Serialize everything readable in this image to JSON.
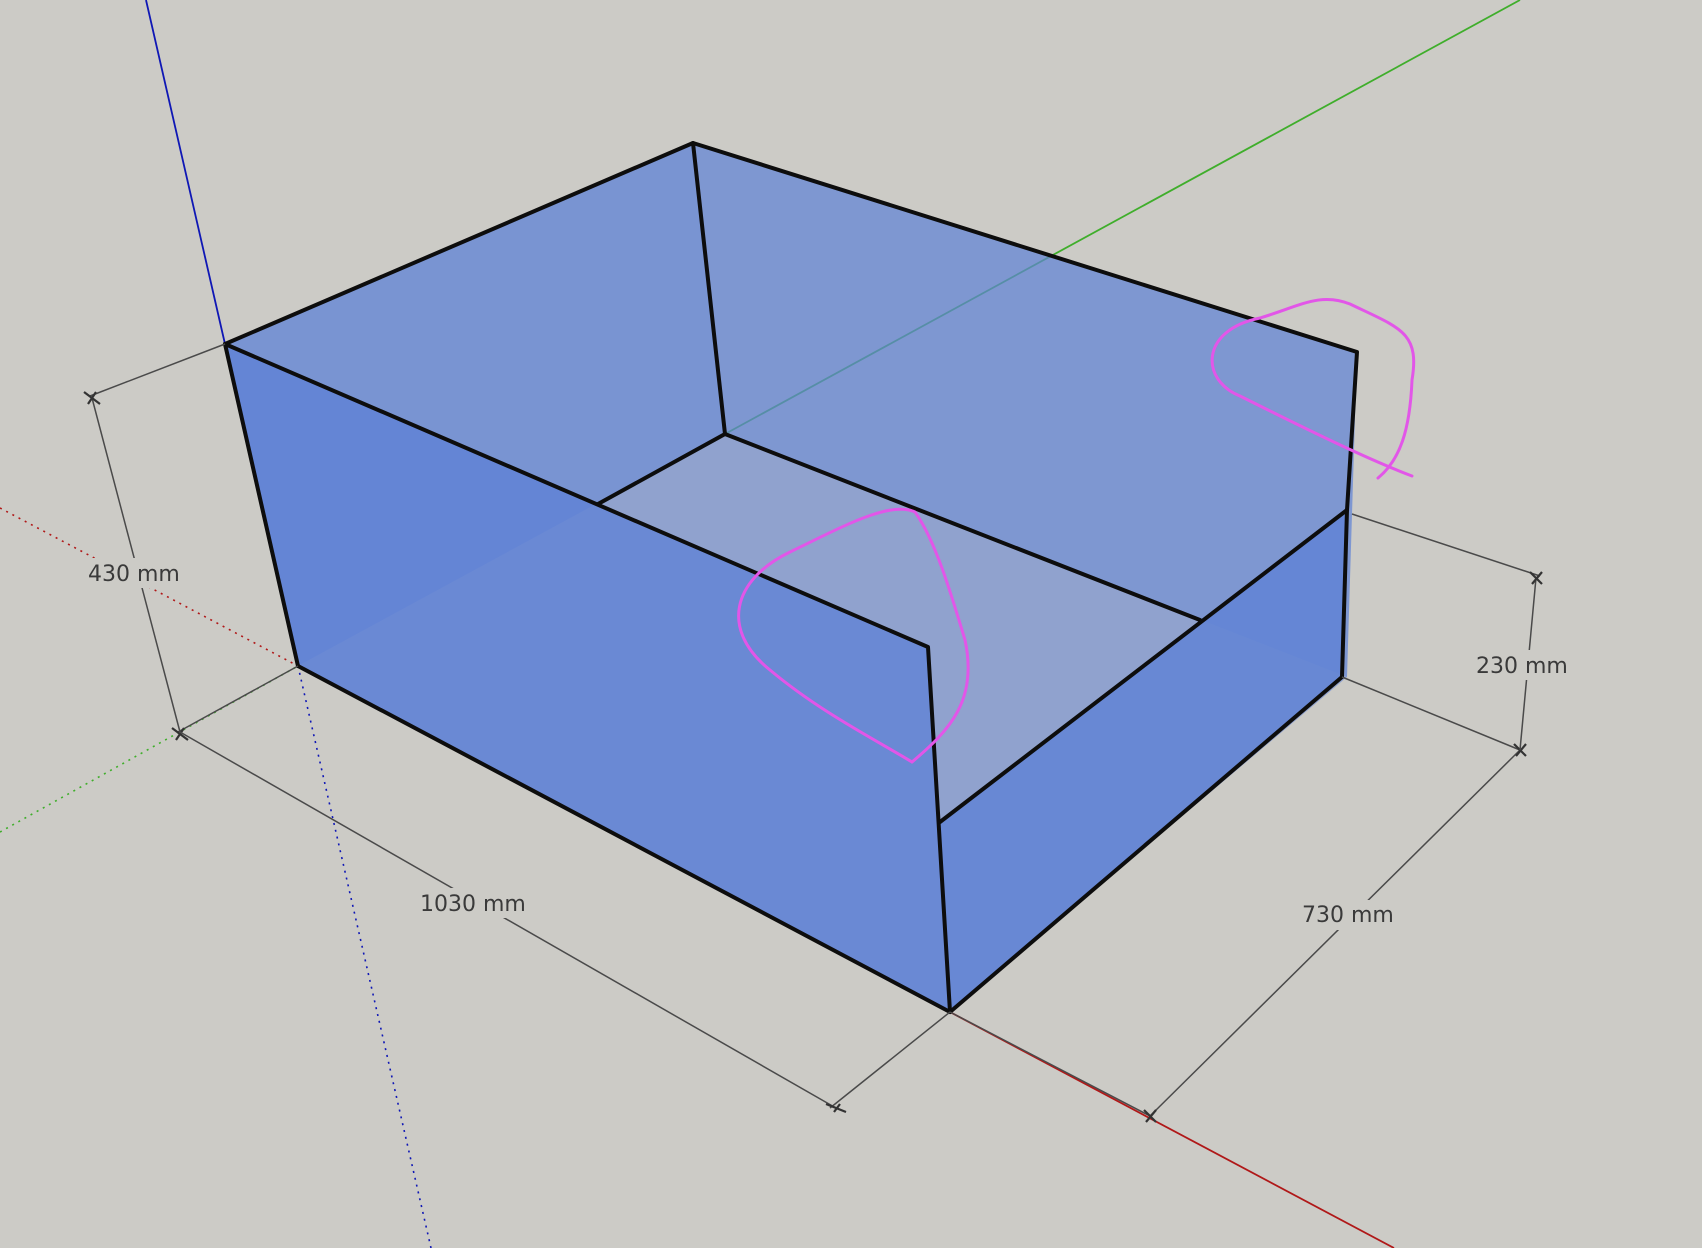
{
  "app": {
    "viewport_background": "#cccbc6"
  },
  "axes": {
    "red_color": "#b01818",
    "green_color": "#3fae2b",
    "blue_color": "#0f17b5"
  },
  "model": {
    "fill_color": "#5f82d6",
    "edge_color": "#0d0d0d"
  },
  "dimensions": {
    "height_total": "430 mm",
    "length": "1030 mm",
    "width": "730 mm",
    "height_low": "230 mm"
  },
  "annotations": {
    "color": "#e256e8",
    "marks": [
      "freehand-loop-center",
      "freehand-loop-right"
    ]
  },
  "icons": {
    "dimension_tick": "arrow-tick-icon"
  }
}
